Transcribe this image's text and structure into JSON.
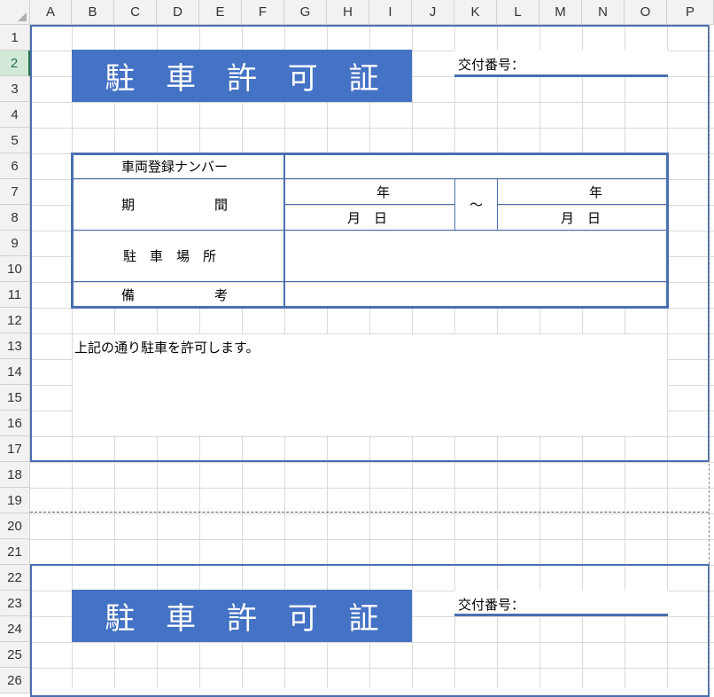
{
  "sheet": {
    "columns": [
      "A",
      "B",
      "C",
      "D",
      "E",
      "F",
      "G",
      "H",
      "I",
      "J",
      "K",
      "L",
      "M",
      "N",
      "O",
      "P"
    ],
    "rows": [
      "1",
      "2",
      "3",
      "4",
      "5",
      "6",
      "7",
      "8",
      "9",
      "10",
      "11",
      "12",
      "13",
      "14",
      "15",
      "16",
      "17",
      "18",
      "19",
      "20",
      "21",
      "22",
      "23",
      "24",
      "25",
      "26"
    ],
    "selected_row": "2"
  },
  "permit_1": {
    "title": "駐 車 許 可 証",
    "issue_number_label": "交付番号：",
    "table": {
      "plate_label": "車両登録ナンバー",
      "period_label": "期　　　　間",
      "year_1": "年",
      "month_day_1": "月　日",
      "tilde": "～",
      "year_2": "年",
      "month_day_2": "月　日",
      "place_label": "駐　車　場　所",
      "remarks_label": "備　　　　考"
    },
    "message": "上記の通り駐車を許可します。"
  },
  "permit_2": {
    "title": "駐 車 許 可 証",
    "issue_number_label": "交付番号："
  },
  "colors": {
    "accent": "#4472c4",
    "border": "#4a6fb0",
    "header_bg": "#f2f2f2",
    "grid_line": "#dadada",
    "selected_header": "#217346"
  }
}
